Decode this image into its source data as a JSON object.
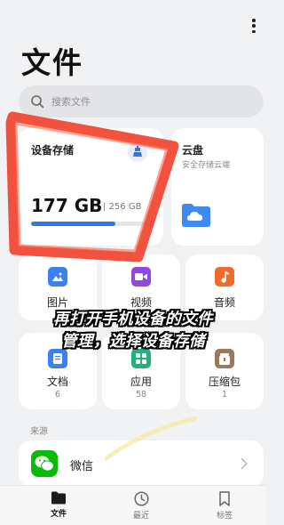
{
  "header": {
    "title": "文件"
  },
  "search": {
    "placeholder": "搜索文件"
  },
  "storage": {
    "title": "设备存储",
    "used": "177 GB",
    "separator_total": "| 256 GB",
    "used_fraction": 0.69
  },
  "cloud": {
    "title": "云盘",
    "subtitle": "安全存储云端"
  },
  "categories": [
    {
      "label": "图片"
    },
    {
      "label": "视频"
    },
    {
      "label": "音频"
    },
    {
      "label": "文档",
      "count": "6"
    },
    {
      "label": "应用",
      "count": "58"
    },
    {
      "label": "压缩包",
      "count": "1"
    }
  ],
  "sources": {
    "label": "来源",
    "items": [
      {
        "label": "微信"
      }
    ]
  },
  "bottom_nav": [
    {
      "label": "文件",
      "active": true
    },
    {
      "label": "最近"
    },
    {
      "label": "标签"
    }
  ],
  "overlay": {
    "caption_lines": [
      "再打开手机设备的文件",
      "管理，选择设备存储"
    ]
  },
  "colors": {
    "accent": "#2f77e8",
    "annotation_red": "#f0442f",
    "caption_stroke": "#000000",
    "wechat_green": "#09bb07"
  },
  "icons": [
    "more-vertical-icon",
    "search-icon",
    "clean-brush-icon",
    "cloud-folder-icon",
    "image-icon",
    "video-icon",
    "music-icon",
    "document-icon",
    "app-icon",
    "archive-icon",
    "wechat-icon",
    "chevron-right-icon",
    "folder-icon",
    "clock-icon",
    "bookmark-icon"
  ]
}
